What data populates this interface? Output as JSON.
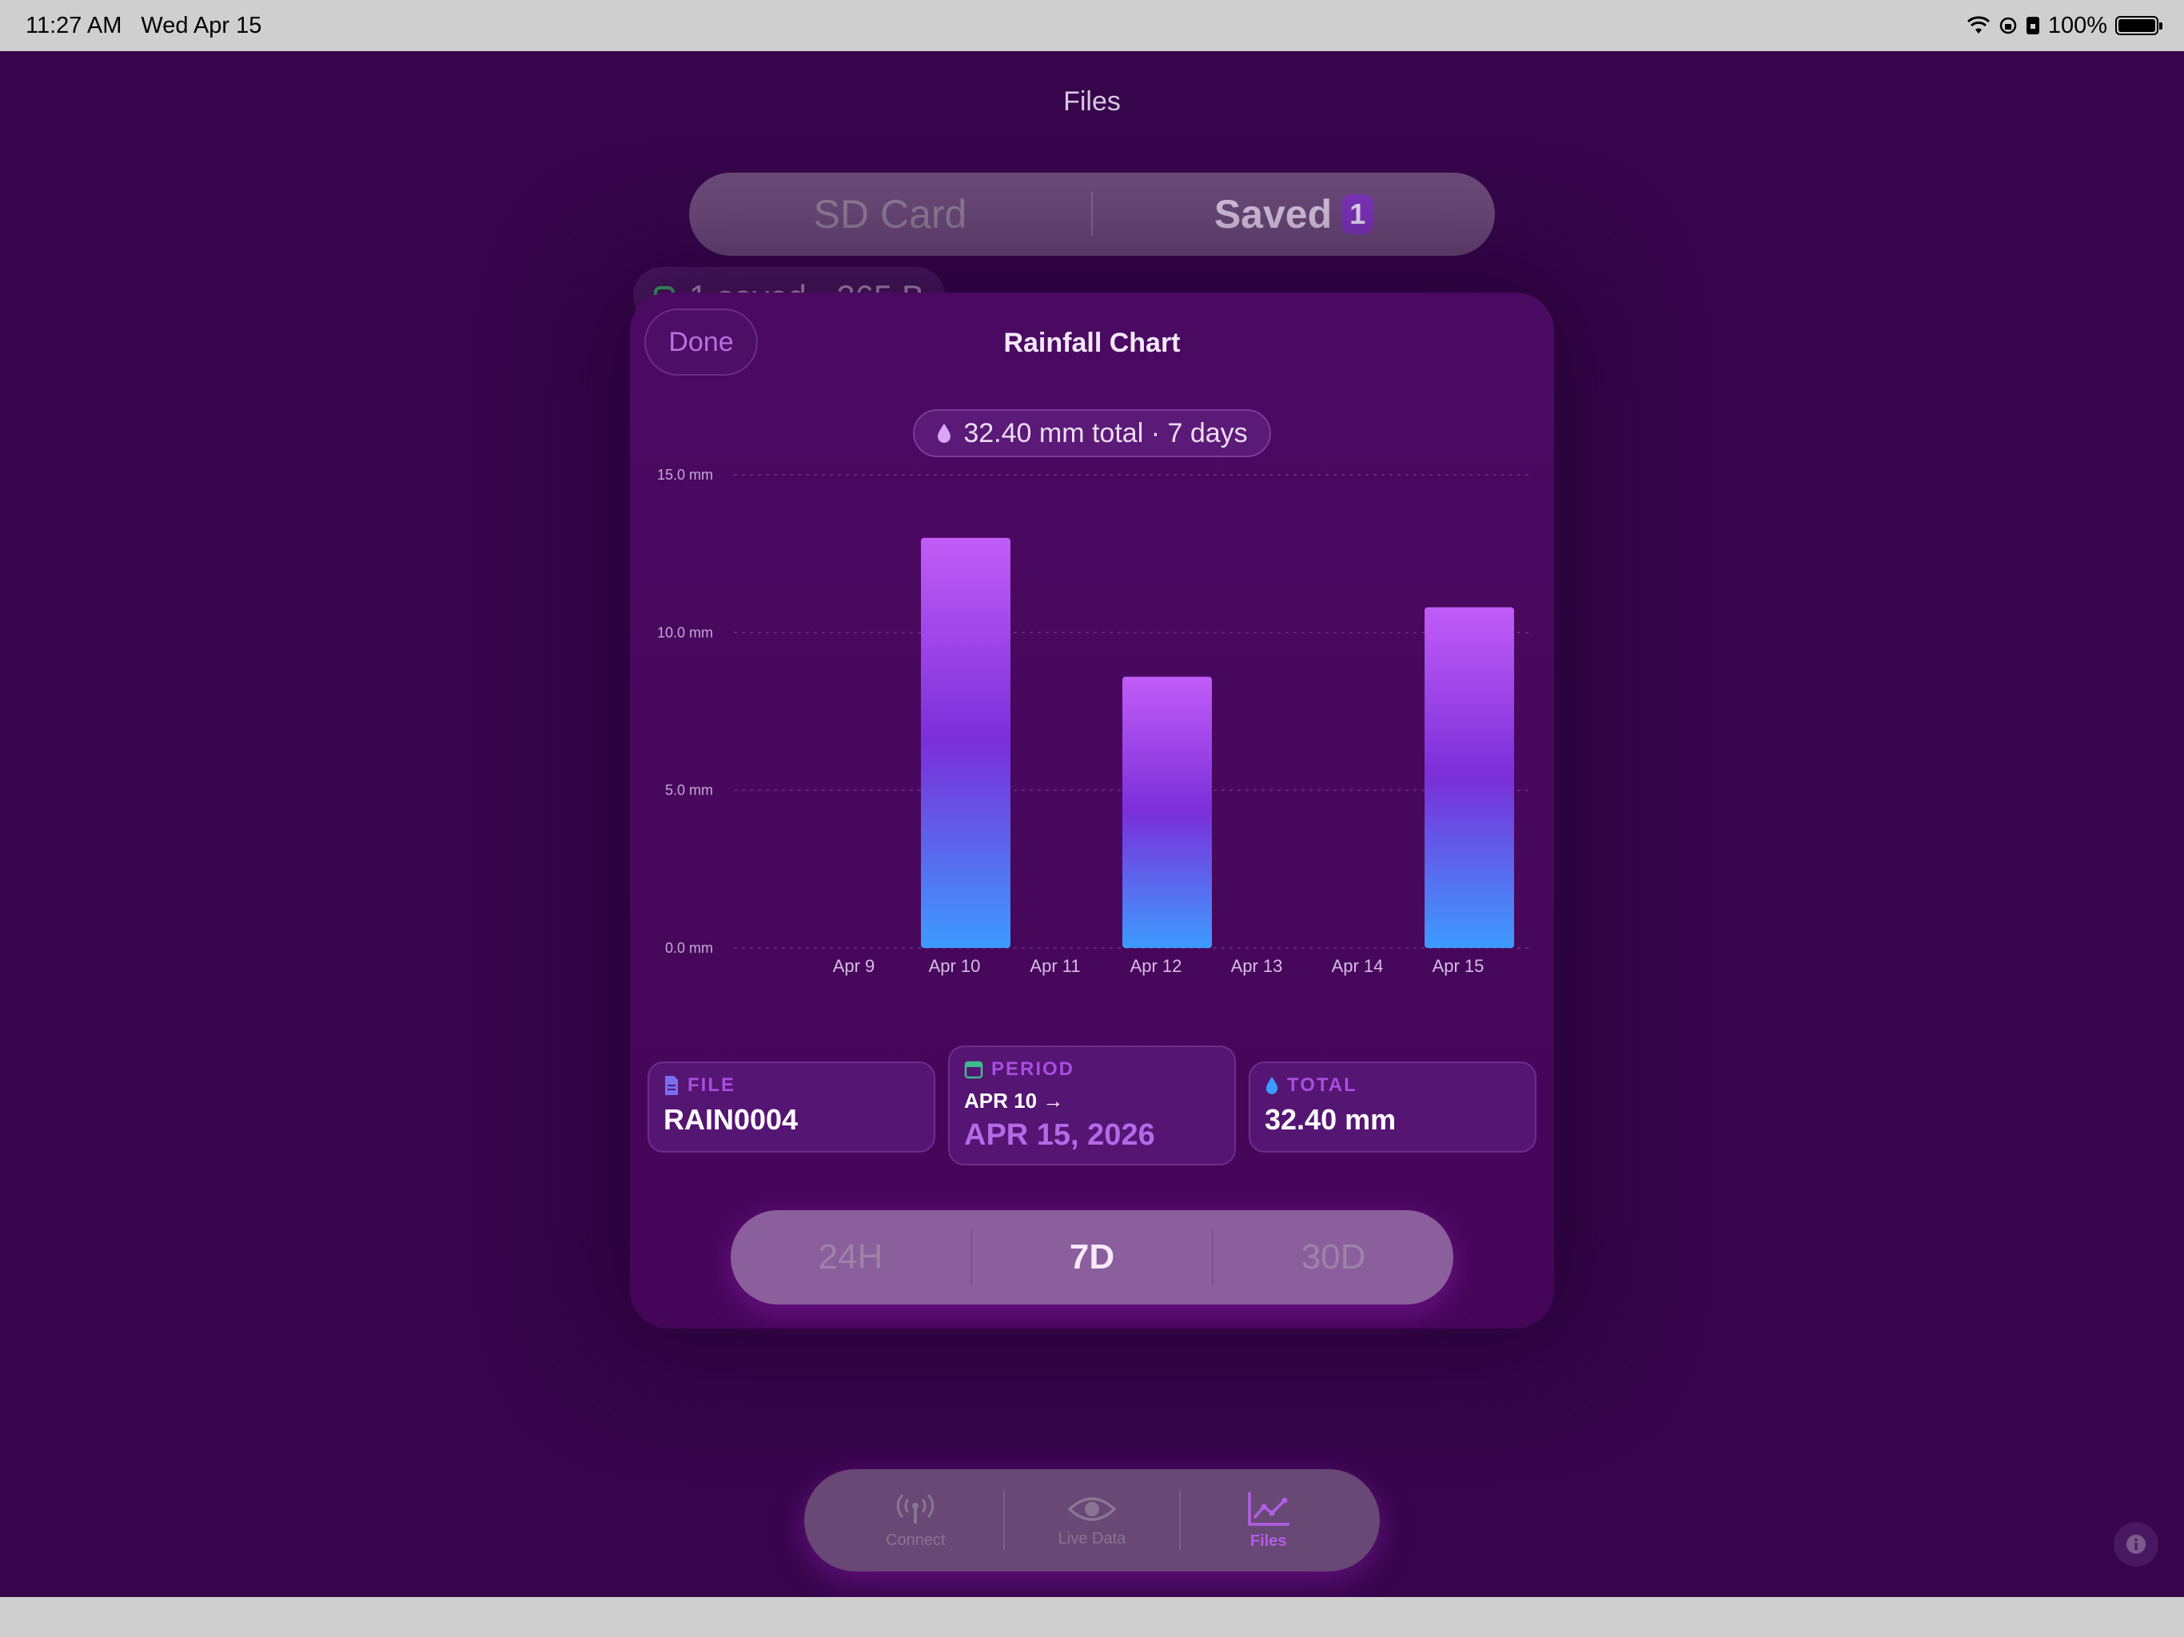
{
  "status_bar": {
    "time": "11:27 AM",
    "date": "Wed Apr 15",
    "battery": "100%"
  },
  "page": {
    "title": "Files",
    "segments": [
      "SD Card",
      "Saved"
    ],
    "saved_badge": "1",
    "behind_pill_text": "1 saved · 265 B"
  },
  "modal": {
    "done_label": "Done",
    "title": "Rainfall Chart",
    "total_pill": "32.40 mm total · 7 days"
  },
  "cards": {
    "file_label": "FILE",
    "file_value": "RAIN0004",
    "period_label": "PERIOD",
    "period_start": "APR 10 →",
    "period_end": "APR 15, 2026",
    "total_label": "TOTAL",
    "total_value": "32.40 mm"
  },
  "range": {
    "options": [
      "24H",
      "7D",
      "30D"
    ],
    "selected": "7D"
  },
  "tabbar": {
    "tabs": [
      {
        "label": "Connect",
        "icon": "antenna-icon"
      },
      {
        "label": "Live Data",
        "icon": "eye-icon"
      },
      {
        "label": "Files",
        "icon": "chart-line-icon"
      }
    ],
    "selected": "Files"
  },
  "colors": {
    "background": "#36054b",
    "modal": "#4b0a62",
    "accent": "#b26ae6",
    "bar_top": "#c15cf7",
    "bar_mid": "#7a2fd9",
    "bar_bottom": "#3d9bff"
  },
  "chart_data": {
    "type": "bar",
    "categories": [
      "Apr 9",
      "Apr 10",
      "Apr 11",
      "Apr 12",
      "Apr 13",
      "Apr 14",
      "Apr 15"
    ],
    "values": [
      0.0,
      13.0,
      0.0,
      8.6,
      0.0,
      0.0,
      10.8
    ],
    "y_ticks": [
      "0.0 mm",
      "5.0 mm",
      "10.0 mm",
      "15.0 mm"
    ],
    "ylim": [
      0,
      15
    ],
    "grid": true
  }
}
